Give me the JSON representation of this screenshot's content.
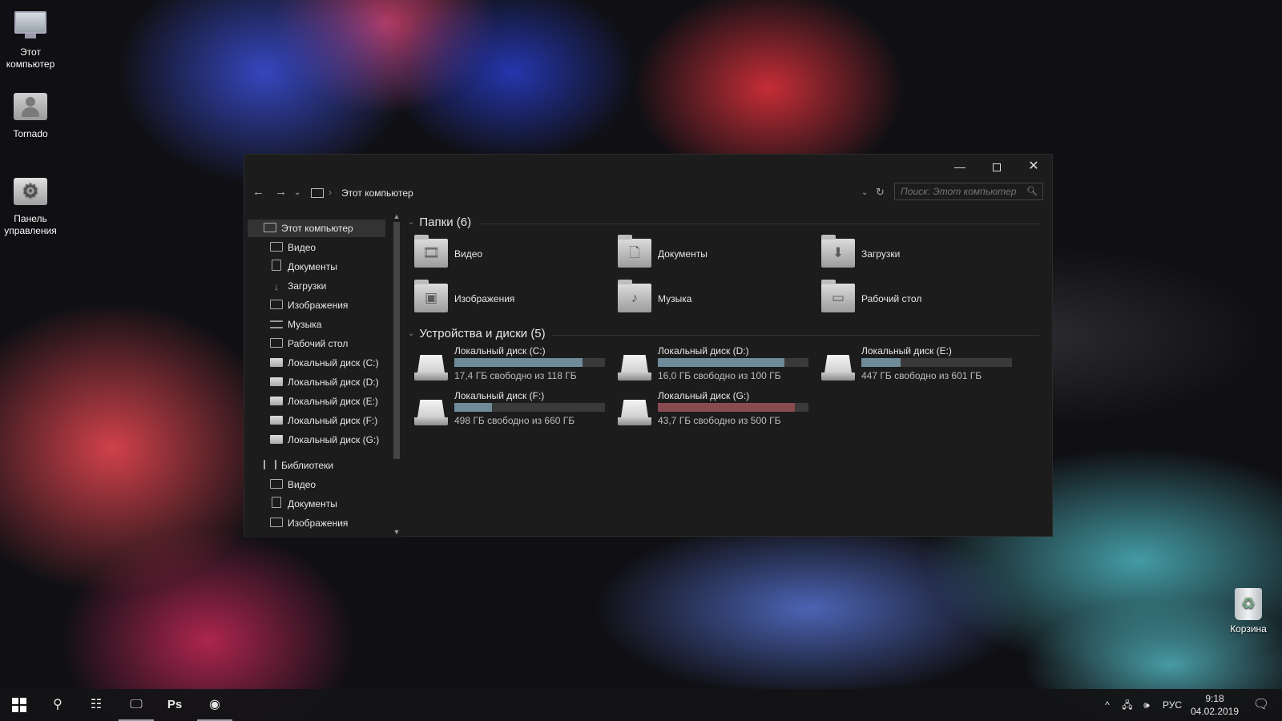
{
  "desktop": {
    "icons": [
      {
        "label": "Этот компьютер",
        "icon": "monitor-icon"
      },
      {
        "label": "Tornado",
        "icon": "user-folder-icon"
      },
      {
        "label": "Панель управления",
        "icon": "control-panel-icon"
      },
      {
        "label": "Корзина",
        "icon": "recycle-bin-icon"
      }
    ]
  },
  "window": {
    "controls": {
      "minimize": "—",
      "close": "✕"
    },
    "address": {
      "location": "Этот компьютер"
    },
    "search": {
      "placeholder": "Поиск: Этот компьютер"
    }
  },
  "navpane": {
    "items": [
      "Этот компьютер",
      "Видео",
      "Документы",
      "Загрузки",
      "Изображения",
      "Музыка",
      "Рабочий стол",
      "Локальный диск (C:)",
      "Локальный диск (D:)",
      "Локальный диск (E:)",
      "Локальный диск (F:)",
      "Локальный диск (G:)",
      "Библиотеки",
      "Видео",
      "Документы",
      "Изображения"
    ]
  },
  "folders": {
    "header": "Папки (6)",
    "items": [
      "Видео",
      "Документы",
      "Загрузки",
      "Изображения",
      "Музыка",
      "Рабочий стол"
    ]
  },
  "drives": {
    "header": "Устройства и диски (5)",
    "items": [
      {
        "name": "Локальный диск (C:)",
        "free": "17,4 ГБ свободно из 118 ГБ",
        "used_pct": 85,
        "warning": false
      },
      {
        "name": "Локальный диск (D:)",
        "free": "16,0 ГБ свободно из 100 ГБ",
        "used_pct": 84,
        "warning": false
      },
      {
        "name": "Локальный диск (E:)",
        "free": "447 ГБ свободно из 601 ГБ",
        "used_pct": 26,
        "warning": false
      },
      {
        "name": "Локальный диск (F:)",
        "free": "498 ГБ свободно из 660 ГБ",
        "used_pct": 25,
        "warning": false
      },
      {
        "name": "Локальный диск (G:)",
        "free": "43,7 ГБ свободно из 500 ГБ",
        "used_pct": 91,
        "warning": true
      }
    ]
  },
  "taskbar": {
    "apps": [
      "start-button",
      "search-button",
      "task-view-button",
      "explorer-app",
      "photoshop-app",
      "chrome-app"
    ],
    "ps_label": "Ps",
    "tray": {
      "language": "РУС",
      "time": "9:18",
      "date": "04.02.2019"
    }
  },
  "colors": {
    "drive_bar": "#6f8b99",
    "drive_bar_warning": "#8a4a52",
    "window_bg": "#1c1c1c"
  }
}
